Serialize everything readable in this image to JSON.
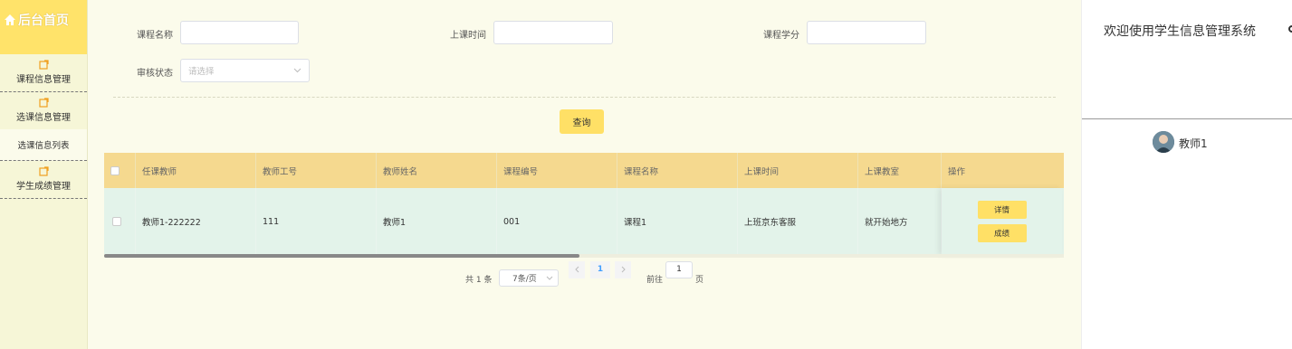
{
  "sidebar": {
    "home_label": "后台首页",
    "items": [
      {
        "label": "课程信息管理"
      },
      {
        "label": "选课信息管理"
      },
      {
        "label": "选课信息列表"
      },
      {
        "label": "学生成绩管理"
      }
    ]
  },
  "search": {
    "course_name_label": "课程名称",
    "class_time_label": "上课时间",
    "credit_label": "课程学分",
    "review_status_label": "审核状态",
    "review_status_placeholder": "请选择",
    "query_button": "查询"
  },
  "table": {
    "headers": [
      "任课教师",
      "教师工号",
      "教师姓名",
      "课程编号",
      "课程名称",
      "上课时间",
      "上课教室",
      "操作"
    ],
    "rows": [
      {
        "teacher": "教师1-222222",
        "teacher_no": "111",
        "teacher_name": "教师1",
        "course_no": "001",
        "course_name": "课程1",
        "class_time": "上班京东客服",
        "classroom": "就开始地方"
      }
    ],
    "row_actions": [
      "详情",
      "成绩"
    ]
  },
  "pagination": {
    "total": "共 1 条",
    "page_size": "7条/页",
    "current_page": "1",
    "goto_label": "前往",
    "goto_value": "1",
    "page_unit": "页"
  },
  "header": {
    "welcome": "欢迎使用学生信息管理系统",
    "user": "教师1"
  },
  "colors": {
    "accent": "#ffe066",
    "table_header": "#f5d98f",
    "row_bg": "#e3f3ea",
    "sidebar_bg": "#f6f6d7"
  }
}
